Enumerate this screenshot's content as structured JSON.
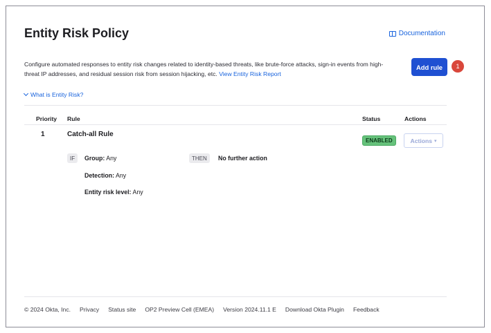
{
  "page": {
    "title": "Entity Risk Policy",
    "documentation_label": "Documentation",
    "description": "Configure automated responses to entity risk changes related to identity-based threats, like brute-force attacks, sign-in events from high-threat IP addresses, and residual session risk from session hijacking, etc.",
    "report_link": "View Entity Risk Report",
    "add_rule_label": "Add rule",
    "notification_count": "1",
    "what_is_label": "What is Entity Risk?"
  },
  "table": {
    "headers": {
      "priority": "Priority",
      "rule": "Rule",
      "status": "Status",
      "actions": "Actions"
    },
    "rows": [
      {
        "priority": "1",
        "name": "Catch-all Rule",
        "status": "ENABLED",
        "actions_label": "Actions",
        "if_tag": "IF",
        "then_tag": "THEN",
        "then_value": "No further action",
        "conditions": [
          {
            "label": "Group:",
            "value": "Any"
          },
          {
            "label": "Detection:",
            "value": "Any"
          },
          {
            "label": "Entity risk level:",
            "value": "Any"
          }
        ]
      }
    ]
  },
  "footer": {
    "copyright": "© 2024 Okta, Inc.",
    "privacy": "Privacy",
    "status_site": "Status site",
    "cell": "OP2 Preview Cell (EMEA)",
    "version": "Version 2024.11.1 E",
    "plugin": "Download Okta Plugin",
    "feedback": "Feedback"
  },
  "colors": {
    "primary_button": "#1f50d2",
    "link": "#1662dd",
    "badge": "#d9473b",
    "enabled_badge": "#66c27b"
  },
  "icons": {
    "documentation": "book-icon",
    "expand": "chevron-down-icon",
    "actions_dropdown": "caret-down-icon"
  }
}
